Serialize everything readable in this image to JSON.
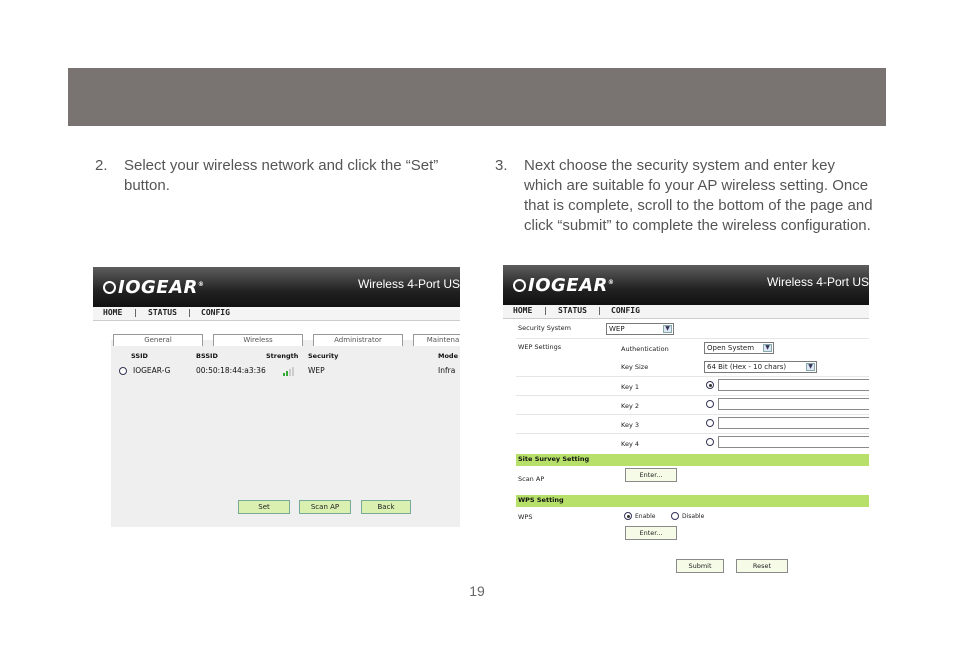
{
  "step2": {
    "number": "2.",
    "text": "Select your wireless network and click the “Set” button."
  },
  "step3": {
    "number": "3.",
    "text": "Next choose the security system and enter key which are suitable fo your AP wireless setting. Once that is complete, scroll to the bottom of the page and click “submit” to complete the wireless configuration."
  },
  "page_number": "19",
  "brand": {
    "logo": "IOGEAR",
    "registered": "®",
    "product_title": "Wireless 4-Port US"
  },
  "nav": {
    "home": "HOME",
    "status": "STATUS",
    "config": "CONFIG",
    "sep": "|"
  },
  "shot1": {
    "tabs": [
      "General",
      "Wireless",
      "Administrator",
      "Maintena"
    ],
    "columns": {
      "ssid": "SSID",
      "bssid": "BSSID",
      "strength": "Strength",
      "security": "Security",
      "mode": "Mode"
    },
    "network": {
      "ssid": "IOGEAR-G",
      "bssid": "00:50:18:44:a3:36",
      "signal_bars": 2,
      "signal_max": 4,
      "security": "WEP",
      "mode": "Infra"
    },
    "buttons": {
      "set": "Set",
      "scan": "Scan AP",
      "back": "Back"
    }
  },
  "shot2": {
    "security_system_label": "Security System",
    "security_system_value": "WEP",
    "wep_settings_label": "WEP Settings",
    "authentication_label": "Authentication",
    "authentication_value": "Open System",
    "key_size_label": "Key Size",
    "key_size_value": "64 Bit (Hex - 10 chars)",
    "keys": [
      "Key 1",
      "Key 2",
      "Key 3",
      "Key 4"
    ],
    "selected_key": "Key 1",
    "site_survey_heading": "Site Survey Setting",
    "scan_ap_label": "Scan AP",
    "enter_button": "Enter...",
    "wps_heading": "WPS Setting",
    "wps_label": "WPS",
    "wps_enable": "Enable",
    "wps_disable": "Disable",
    "wps_enter_button": "Enter...",
    "submit_button": "Submit",
    "reset_button": "Reset"
  },
  "colors": {
    "header_band": "#797472",
    "green_accent": "#b6e06a"
  }
}
